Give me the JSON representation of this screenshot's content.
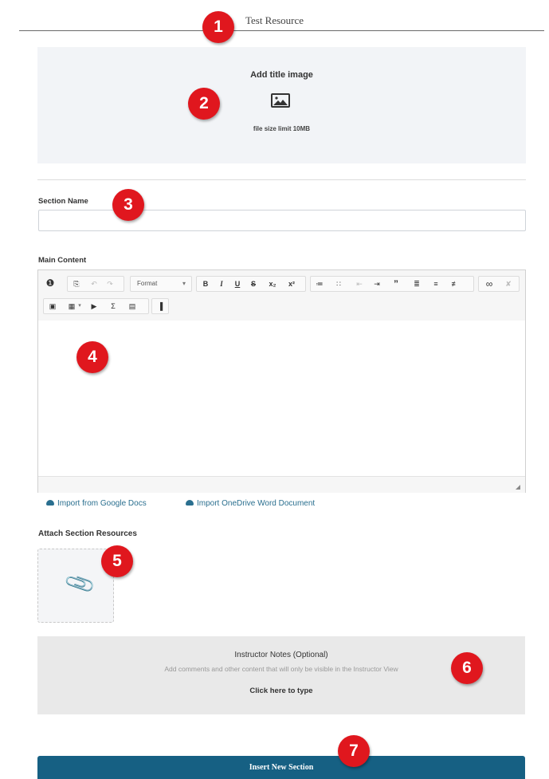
{
  "header": {
    "title": "Test Resource"
  },
  "title_image": {
    "label": "Add title image",
    "icon": "image-icon",
    "limit": "file size limit 10MB"
  },
  "section_name": {
    "label": "Section Name",
    "value": "",
    "placeholder": ""
  },
  "main_content": {
    "label": "Main Content",
    "toolbar": {
      "info_icon": "❶",
      "paste_icon": "⎘",
      "undo": "↶",
      "redo": "↷",
      "format": "Format",
      "format_caret": "▾",
      "bold": "B",
      "italic": "I",
      "underline": "U",
      "strike": "S",
      "subscript": "x₂",
      "superscript": "x²",
      "ordered_list": "≔",
      "bullet_list": "∷",
      "outdent": "⇤",
      "indent": "⇥",
      "blockquote": "”",
      "align_left": "≣",
      "align_center": "≡",
      "align_right": "≢",
      "link": "∞",
      "unlink": "✘",
      "image": "▣",
      "table": "▦",
      "table_caret": "▾",
      "video": "▶",
      "sigma": "Σ",
      "book": "▤",
      "chart": "▐"
    },
    "editor_text": ""
  },
  "imports": {
    "google": "Import from Google Docs",
    "onedrive": "Import OneDrive Word Document"
  },
  "attach": {
    "label": "Attach Section Resources",
    "icon": "📎"
  },
  "instructor_notes": {
    "title": "Instructor Notes (Optional)",
    "description": "Add comments and other content that will only be visible in the Instructor View",
    "cta": "Click here to type"
  },
  "insert_button": {
    "label": "Insert New Section"
  },
  "callouts": [
    "1",
    "2",
    "3",
    "4",
    "5",
    "6",
    "7"
  ],
  "colors": {
    "primary": "#166083",
    "callout": "#e0171e",
    "link": "#2a6f8f"
  }
}
